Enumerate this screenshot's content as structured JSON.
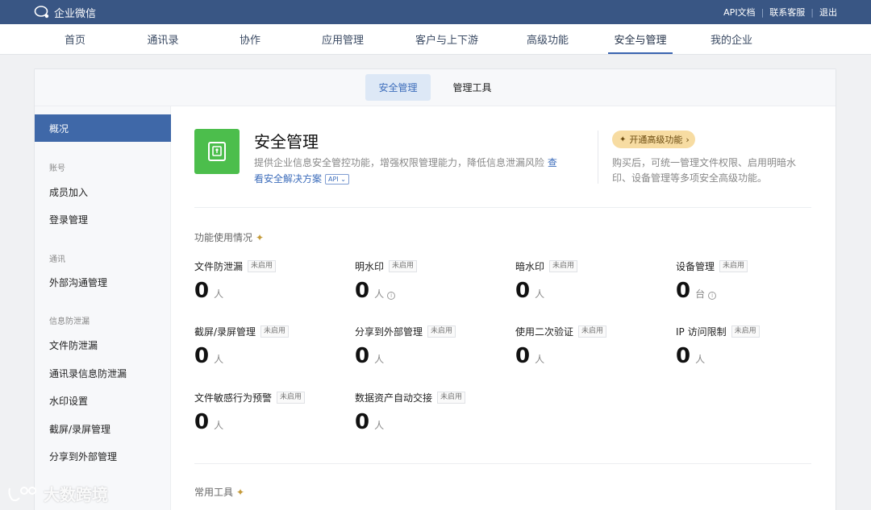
{
  "app": {
    "brand": "企业微信"
  },
  "toplinks": [
    "API文档",
    "联系客服",
    "退出"
  ],
  "nav": {
    "items": [
      "首页",
      "通讯录",
      "协作",
      "应用管理",
      "客户与上下游",
      "高级功能",
      "安全与管理",
      "我的企业"
    ],
    "active_index": 6
  },
  "subtabs": [
    "安全管理",
    "管理工具"
  ],
  "sidebar": {
    "active": "概况",
    "groups": [
      {
        "label": "账号",
        "items": [
          "成员加入",
          "登录管理"
        ]
      },
      {
        "label": "通讯",
        "items": [
          "外部沟通管理"
        ]
      },
      {
        "label": "信息防泄漏",
        "items": [
          "文件防泄漏",
          "通讯录信息防泄漏",
          "水印设置",
          "截屏/录屏管理",
          "分享到外部管理"
        ]
      }
    ]
  },
  "security": {
    "title": "安全管理",
    "desc": "提供企业信息安全管控功能，增强权限管理能力，降低信息泄漏风险",
    "solution_link": "查看安全解决方案",
    "api_tag": "API",
    "upgrade_button": "开通高级功能",
    "upgrade_desc": "购买后，可统一管理文件权限、启用明暗水印、设备管理等多项安全高级功能。"
  },
  "usage": {
    "label": "功能使用情况",
    "metrics": [
      {
        "name": "文件防泄漏",
        "badge": "未启用",
        "value": "0",
        "unit": "人"
      },
      {
        "name": "明水印",
        "badge": "未启用",
        "value": "0",
        "unit": "人"
      },
      {
        "name": "暗水印",
        "badge": "未启用",
        "value": "0",
        "unit": "人"
      },
      {
        "name": "设备管理",
        "badge": "未启用",
        "value": "0",
        "unit": "台"
      },
      {
        "name": "截屏/录屏管理",
        "badge": "未启用",
        "value": "0",
        "unit": "人"
      },
      {
        "name": "分享到外部管理",
        "badge": "未启用",
        "value": "0",
        "unit": "人"
      },
      {
        "name": "使用二次验证",
        "badge": "未启用",
        "value": "0",
        "unit": "人"
      },
      {
        "name": "IP 访问限制",
        "badge": "未启用",
        "value": "0",
        "unit": "人"
      },
      {
        "name": "文件敏感行为预警",
        "badge": "未启用",
        "value": "0",
        "unit": "人"
      },
      {
        "name": "数据资产自动交接",
        "badge": "未启用",
        "value": "0",
        "unit": "人"
      }
    ]
  },
  "tools": {
    "label": "常用工具"
  },
  "watermark": {
    "text": "大数跨境"
  }
}
